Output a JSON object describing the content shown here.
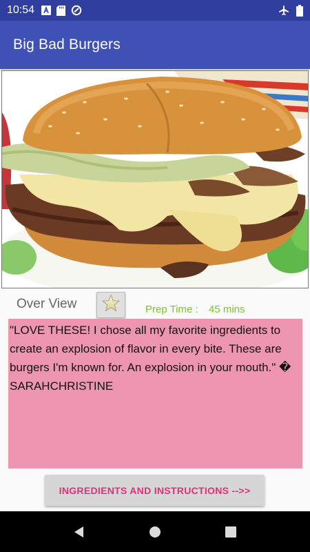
{
  "status_bar": {
    "time": "10:54",
    "icons_left": [
      "a-notification-icon",
      "sd-card-icon",
      "sync-icon"
    ],
    "icons_right": [
      "airplane-mode-icon",
      "battery-icon"
    ]
  },
  "app_bar": {
    "title": "Big Bad Burgers"
  },
  "hero": {
    "image": "burger-photo"
  },
  "overview": {
    "label": "Over View",
    "favorite_icon": "star-icon"
  },
  "prep": {
    "label": "Prep Time :",
    "value": "45 mins"
  },
  "description": {
    "text": "\"LOVE THESE! I chose all my favorite ingredients to create an explosion of flavor in every bite. These are burgers I'm known for. An explosion in your mouth.\" � SARAHCHRISTINE"
  },
  "ingredients_button": {
    "label": "INGREDIENTS AND INSTRUCTIONS -->>"
  },
  "nav_bar": {
    "back": "back-icon",
    "home": "home-icon",
    "recents": "recents-icon"
  },
  "colors": {
    "status_bar": "#303f9f",
    "app_bar": "#3f51b5",
    "description_bg": "#ee96b0",
    "prep_text": "#7cc230",
    "button_text": "#e0307a"
  }
}
